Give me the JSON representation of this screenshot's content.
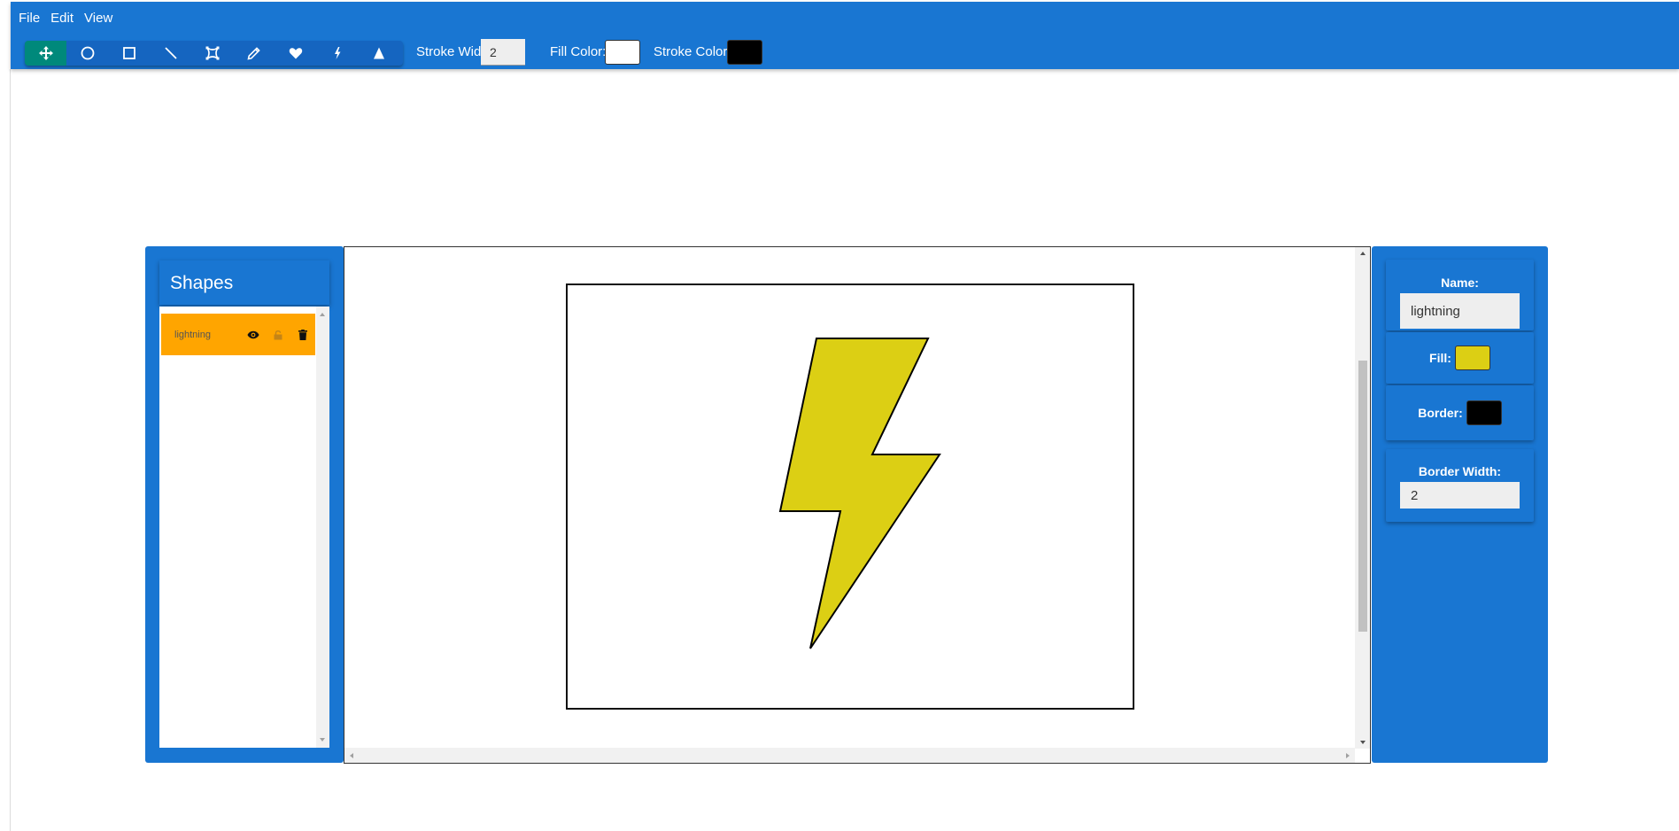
{
  "menu": {
    "file": "File",
    "edit": "Edit",
    "view": "View"
  },
  "toolbar": {
    "tools": [
      "move-icon",
      "circle-icon",
      "rectangle-icon",
      "line-icon",
      "bezier-icon",
      "pencil-icon",
      "heart-icon",
      "lightning-icon",
      "triangle-icon"
    ],
    "active_tool": "move-icon",
    "stroke_width_label": "Stroke Width:",
    "stroke_width_value": "2",
    "fill_color_label": "Fill Color:",
    "fill_color": "#ffffff",
    "stroke_color_label": "Stroke Color:",
    "stroke_color": "#000000"
  },
  "shapes_panel": {
    "title": "Shapes",
    "items": [
      {
        "name": "lightning",
        "icons": [
          "eye-icon",
          "lock-icon",
          "trash-icon"
        ]
      }
    ]
  },
  "properties": {
    "name_label": "Name:",
    "name_value": "lightning",
    "fill_label": "Fill:",
    "fill_color": "#dccf14",
    "border_label": "Border:",
    "border_color": "#000000",
    "border_width_label": "Border Width:",
    "border_width_value": "2"
  },
  "colors": {
    "primary": "#1976d2",
    "active_tool": "#00897b",
    "selected_item": "#ffa500",
    "shape_fill": "#dccf14"
  }
}
